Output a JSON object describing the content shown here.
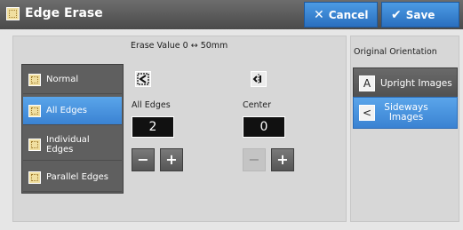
{
  "header": {
    "title": "Edge Erase",
    "cancel_label": "Cancel",
    "save_label": "Save"
  },
  "main": {
    "erase_value_label": "Erase Value 0 ↔ 50mm",
    "modes": [
      {
        "label": "Normal",
        "selected": false
      },
      {
        "label": "All Edges",
        "selected": true
      },
      {
        "label": "Individual Edges",
        "selected": false
      },
      {
        "label": "Parallel Edges",
        "selected": false
      }
    ],
    "all_edges": {
      "label": "All Edges",
      "value": "2",
      "minus": "−",
      "plus": "+"
    },
    "center": {
      "label": "Center",
      "value": "0",
      "minus": "−",
      "plus": "+"
    }
  },
  "orientation": {
    "label": "Original Orientation",
    "upright_label": "Upright Images",
    "upright_icon_text": "A",
    "sideways_label": "Sideways Images",
    "sideways_icon_text": "<",
    "selected": "sideways"
  },
  "colors": {
    "accent": "#3a82d2",
    "header_bg": "#4a4a4a",
    "field_bg": "#111111"
  }
}
